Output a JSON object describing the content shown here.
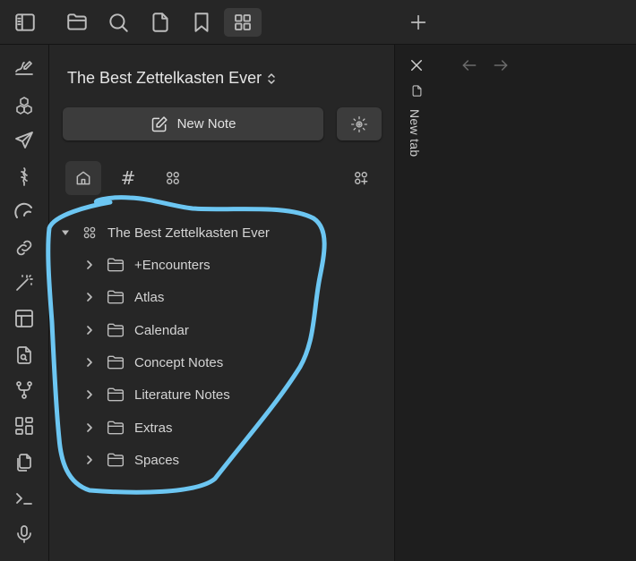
{
  "topbar": {
    "icons": [
      "sidebar-toggle-icon",
      "folder-icon",
      "search-icon",
      "file-icon",
      "bookmark-icon",
      "grid-icon"
    ]
  },
  "ribbon": {
    "icons": [
      "handwriting-icon",
      "boxes-icon",
      "send-icon",
      "knot-icon",
      "arc-icon",
      "link-icon",
      "magic-wand-icon",
      "layout-icon",
      "file-search-icon",
      "git-fork-icon",
      "dashboard-icon",
      "copy-icon",
      "terminal-icon",
      "microphone-icon"
    ]
  },
  "vault": {
    "title": "The Best Zettelkasten Ever"
  },
  "new_note": {
    "label": "New Note"
  },
  "view_tabs": {
    "hash_label": "#"
  },
  "tree": {
    "root_label": "The Best Zettelkasten Ever",
    "folders": [
      {
        "label": "+Encounters"
      },
      {
        "label": "Atlas"
      },
      {
        "label": "Calendar"
      },
      {
        "label": "Concept Notes"
      },
      {
        "label": "Literature Notes"
      },
      {
        "label": "Extras"
      },
      {
        "label": "Spaces"
      }
    ]
  },
  "right_pane": {
    "new_tab_label": "New tab"
  },
  "colors": {
    "annotation": "#6cc6f2",
    "panel_bg": "#262626",
    "editor_bg": "#1e1e1e",
    "button_bg": "#3c3c3c"
  }
}
